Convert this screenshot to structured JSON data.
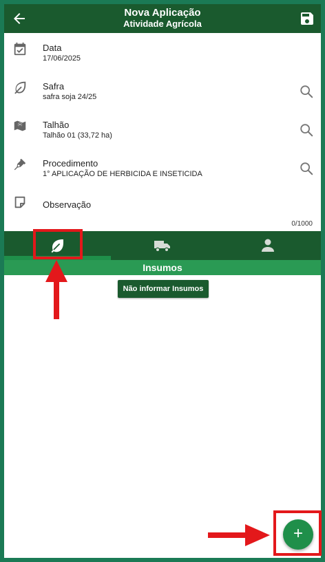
{
  "header": {
    "title": "Nova Aplicação",
    "subtitle": "Atividade Agrícola",
    "back_icon": "arrow-left-icon",
    "save_icon": "floppy-disk-icon"
  },
  "form": {
    "data": {
      "label": "Data",
      "value": "17/06/2025",
      "icon": "calendar-check-icon"
    },
    "safra": {
      "label": "Safra",
      "value": "safra soja 24/25",
      "icon": "leaf-icon"
    },
    "talhao": {
      "label": "Talhão",
      "value": "Talhão 01 (33,72 ha)",
      "icon": "map-pin-icon"
    },
    "procedimento": {
      "label": "Procedimento",
      "value": "1° APLICAÇÃO DE HERBICIDA E INSETICIDA",
      "icon": "pen-icon"
    },
    "observacao": {
      "label": "Observação",
      "icon": "sticky-note-icon",
      "counter": "0/1000"
    }
  },
  "tabs": [
    {
      "name": "insumos",
      "icon": "leaf-icon",
      "selected": true
    },
    {
      "name": "transport",
      "icon": "truck-icon",
      "selected": false
    },
    {
      "name": "person",
      "icon": "person-icon",
      "selected": false
    }
  ],
  "section": {
    "title": "Insumos"
  },
  "actions": {
    "no_insumos_label": "Não informar Insumos",
    "fab_label": "+"
  },
  "colors": {
    "header_bg": "#1a5a2e",
    "accent": "#1f8f4a",
    "annotation": "#e3181b",
    "frame": "#1b7a55"
  }
}
